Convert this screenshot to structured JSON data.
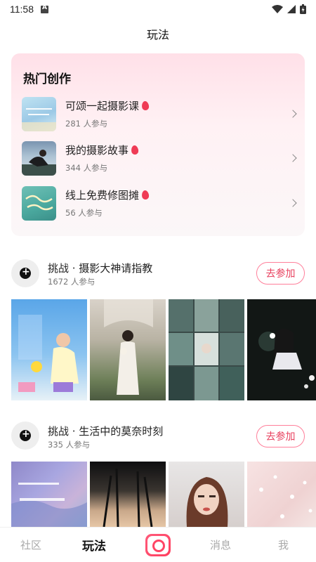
{
  "status_bar": {
    "time": "11:58"
  },
  "header": {
    "title": "玩法"
  },
  "hot": {
    "title": "热门创作",
    "items": [
      {
        "name": "可颂一起摄影课",
        "count": "281 人参与"
      },
      {
        "name": "我的摄影故事",
        "count": "344 人参与"
      },
      {
        "name": "线上免费修图摊",
        "count": "56 人参与"
      }
    ]
  },
  "challenges": [
    {
      "title": "挑战 · 摄影大神请指教",
      "count": "1672 人参与",
      "join_label": "去参加"
    },
    {
      "title": "挑战 · 生活中的莫奈时刻",
      "count": "335 人参与",
      "join_label": "去参加"
    }
  ],
  "tabs": {
    "community": "社区",
    "play": "玩法",
    "messages": "消息",
    "me": "我"
  },
  "colors": {
    "accent": "#e8405e",
    "hot_card_top": "#ffe0e8",
    "flame": "#ef3b55"
  },
  "icons": [
    "wifi-icon",
    "battery-icon",
    "flame-icon",
    "chevron-right-icon",
    "add-circle-icon",
    "camera-icon"
  ]
}
